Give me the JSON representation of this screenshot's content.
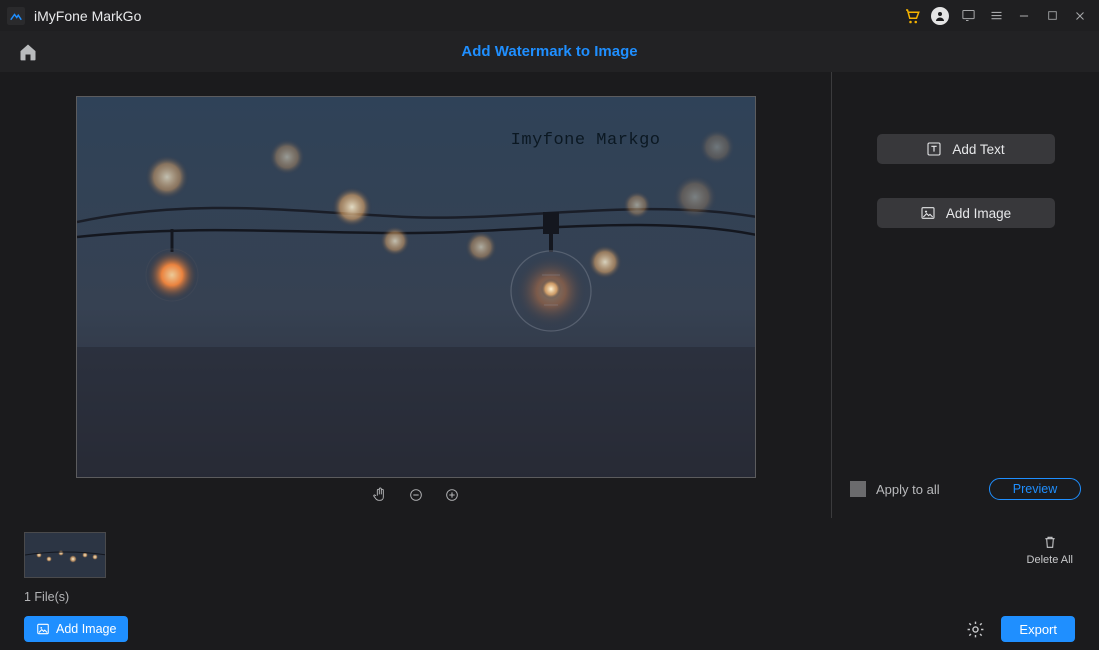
{
  "titlebar": {
    "app_title": "iMyFone MarkGo",
    "icons": {
      "cart": "cart-icon",
      "user": "user-icon",
      "feedback": "feedback-icon",
      "menu": "menu-icon",
      "minimize": "minimize-icon",
      "maximize": "maximize-icon",
      "close": "close-icon"
    }
  },
  "header": {
    "home_icon": "home-icon",
    "title": "Add Watermark to Image"
  },
  "canvas": {
    "watermark_text": "Imyfone Markgo",
    "tools": {
      "pan": "hand-icon",
      "zoom_out": "zoom-out-icon",
      "zoom_in": "zoom-in-icon"
    }
  },
  "right_panel": {
    "add_text_label": "Add Text",
    "add_image_label": "Add Image",
    "apply_label": "Apply to all",
    "preview_label": "Preview"
  },
  "thumbs": {
    "file_count": "1 File(s)",
    "delete_all_label": "Delete All"
  },
  "bottom": {
    "add_image_label": "Add Image",
    "export_label": "Export",
    "settings_icon": "gear-icon"
  },
  "colors": {
    "accent": "#1f8fff",
    "bg": "#1b1b1d",
    "panel": "#222224"
  }
}
